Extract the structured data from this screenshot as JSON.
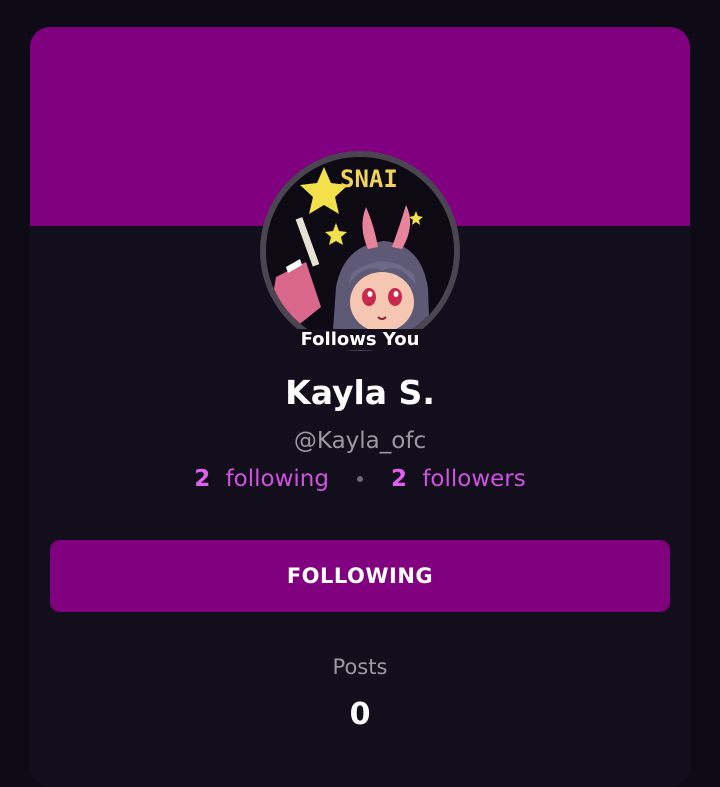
{
  "profile": {
    "follows_you": "Follows You",
    "name": "Kayla S.",
    "handle": "@Kayla_ofc",
    "following_count": "2",
    "following_label": "following",
    "followers_count": "2",
    "followers_label": "followers",
    "avatar_text": "SNAI"
  },
  "actions": {
    "follow_button_label": "FOLLOWING"
  },
  "posts": {
    "label": "Posts",
    "count": "0"
  },
  "colors": {
    "accent": "#800080",
    "highlight": "#e060f0",
    "background": "#0f0b16"
  }
}
